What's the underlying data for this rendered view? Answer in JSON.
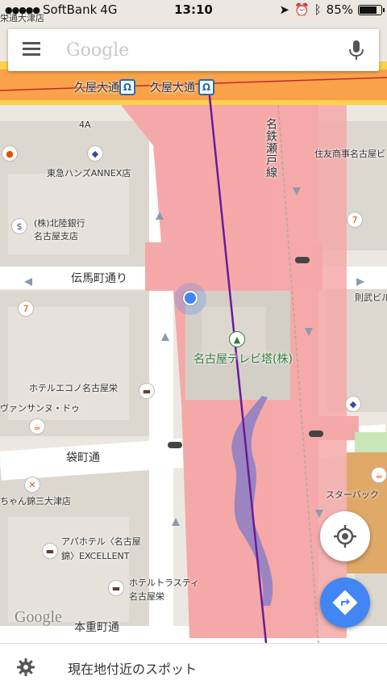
{
  "status_bar": {
    "signal": "●●●●●",
    "carrier": "SoftBank",
    "network": "4G",
    "time": "13:10",
    "battery": "85%",
    "battery_level": 0.85
  },
  "search": {
    "placeholder": "Google"
  },
  "map_labels": {
    "top_street": "栄通大津店",
    "hisaya_odori_1": "久屋大通",
    "hisaya_odori_2": "久屋大通",
    "road_4a": "4A",
    "meitetsu_seto_line": "名鉄瀬戸線",
    "sumitomo": "住友商事名古屋ビ",
    "tokyu_hands": "東急ハンズANNEX店",
    "hokuriku_bank_1": "(株)北陸銀行",
    "hokuriku_bank_2": "名古屋支店",
    "tenmacho_dori": "伝馬町通り",
    "norifu_bldg": "則武ビル",
    "tv_tower": "名古屋テレビ塔(株)",
    "hotel_econo": "ホテルエコノ名古屋栄",
    "vansan": "ヴァンサンヌ・ドゥ",
    "fukuromachi_dori": "袋町通",
    "starbucks": "スターバック",
    "chanko": "ちゃん錦三大津店",
    "apa_1": "アパホテル〈名古屋",
    "apa_2": "錦〉EXCELLENT",
    "trusty_1": "ホテルトラスティ",
    "trusty_2": "名古屋栄",
    "honjumachi_dori": "本重町通",
    "google_logo": "Google"
  },
  "bottom_bar": {
    "label": "現在地付近のスポット"
  },
  "colors": {
    "park": "#f4a9a8",
    "main_road": "#f9a24a",
    "subway_line": "#6a1b9a",
    "water": "#8a7fc4",
    "accent": "#4285f4"
  },
  "icons": [
    "menu-icon",
    "mic-icon",
    "my-location-icon",
    "directions-icon",
    "settings-icon",
    "station-icon"
  ]
}
